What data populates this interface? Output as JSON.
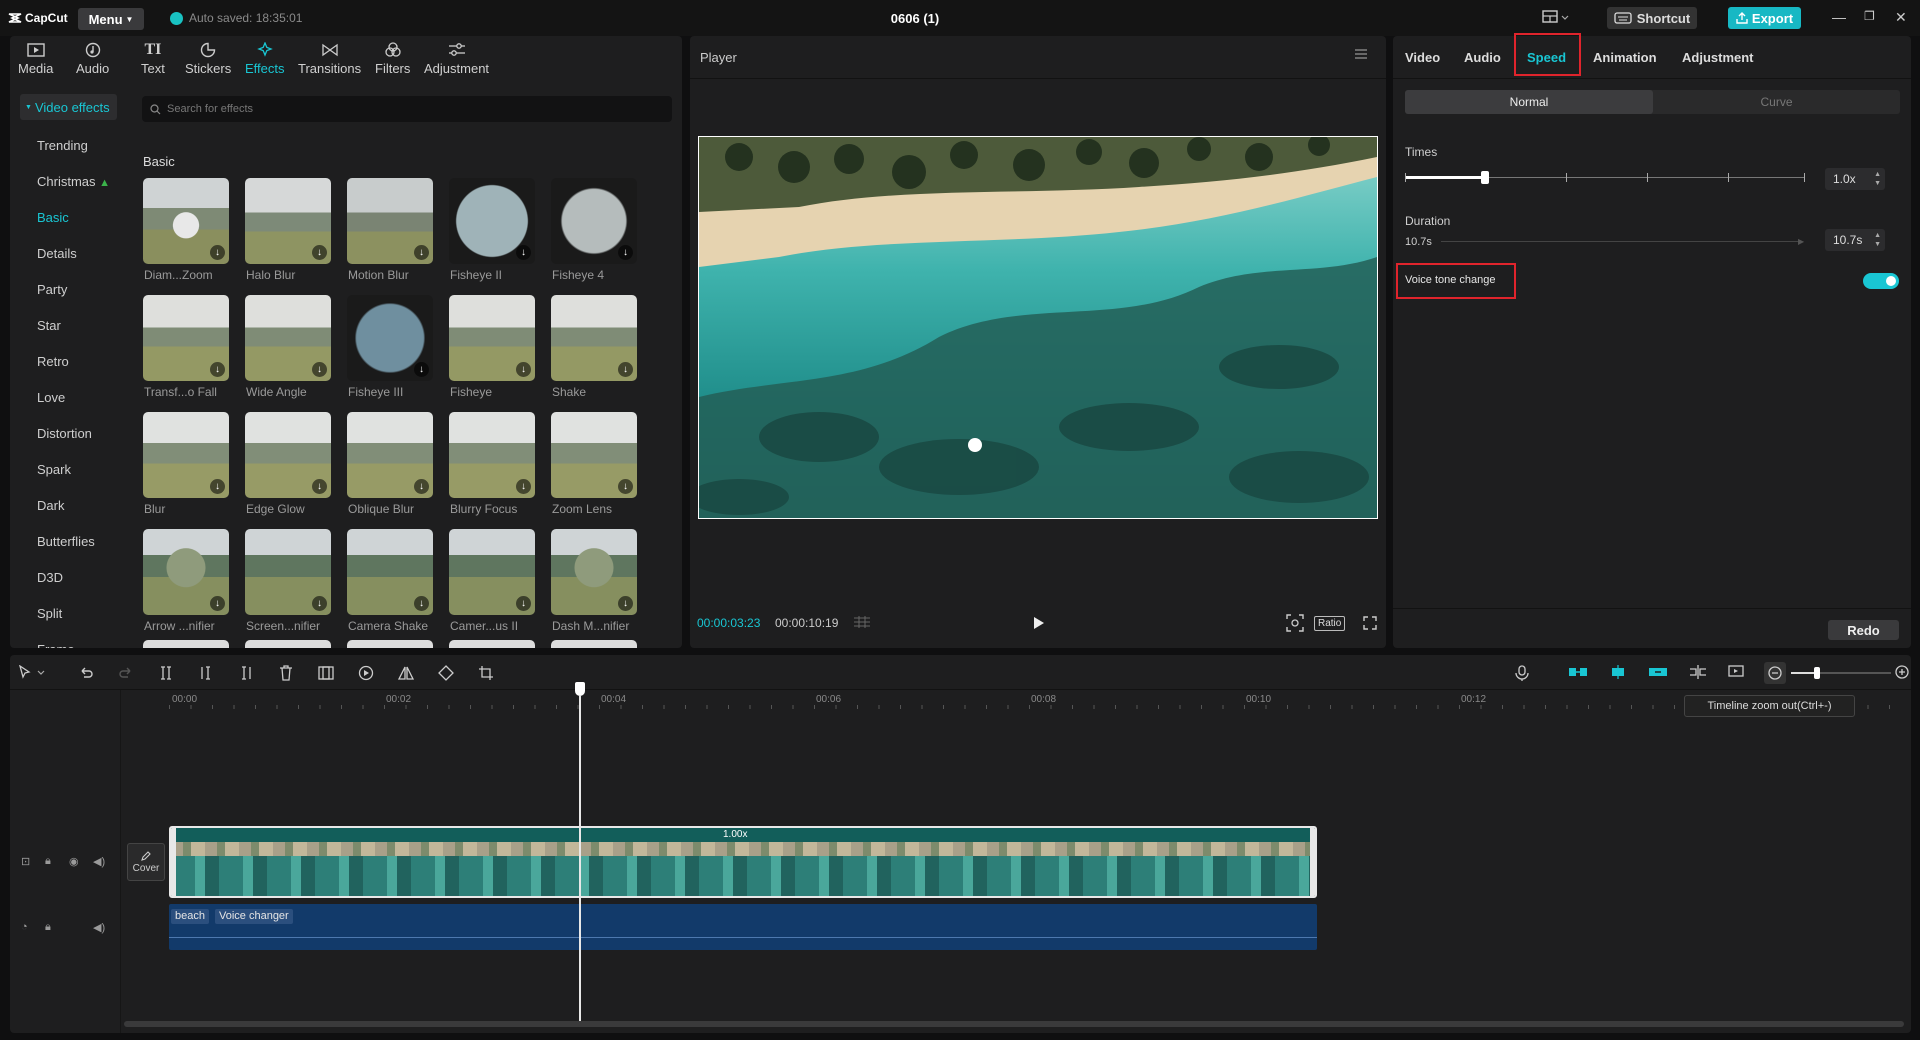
{
  "titlebar": {
    "logo": "CapCut",
    "menu": "Menu",
    "auto_saved": "Auto saved: 18:35:01",
    "project": "0606 (1)",
    "shortcut": "Shortcut",
    "export": "Export"
  },
  "toolbar": {
    "tabs": [
      "Media",
      "Audio",
      "Text",
      "Stickers",
      "Effects",
      "Transitions",
      "Filters",
      "Adjustment"
    ],
    "active": "Effects"
  },
  "effects": {
    "category": "Video effects",
    "nav": [
      "Trending",
      "Christmas",
      "Basic",
      "Details",
      "Party",
      "Star",
      "Retro",
      "Love",
      "Distortion",
      "Spark",
      "Dark",
      "Butterflies",
      "D3D",
      "Split",
      "Frame"
    ],
    "active_nav": "Basic",
    "search_placeholder": "Search for effects",
    "section": "Basic",
    "items": [
      "Diam...Zoom",
      "Halo Blur",
      "Motion Blur",
      "Fisheye II",
      "Fisheye 4",
      "Transf...o Fall",
      "Wide Angle",
      "Fisheye III",
      "Fisheye",
      "Shake",
      "Blur",
      "Edge Glow",
      "Oblique Blur",
      "Blurry Focus",
      "Zoom Lens",
      "Arrow ...nifier",
      "Screen...nifier",
      "Camera Shake",
      "Camer...us II",
      "Dash M...nifier"
    ]
  },
  "player": {
    "title": "Player",
    "current_time": "00:00:03:23",
    "total_time": "00:00:10:19",
    "ratio": "Ratio"
  },
  "inspector": {
    "tabs": [
      "Video",
      "Audio",
      "Speed",
      "Animation",
      "Adjustment"
    ],
    "active_tab": "Speed",
    "mode_normal": "Normal",
    "mode_curve": "Curve",
    "times_label": "Times",
    "times_value": "1.0x",
    "times_level": 0.2,
    "duration_label": "Duration",
    "duration_left": "10.7s",
    "duration_value": "10.7s",
    "voice_tone_label": "Voice tone change",
    "voice_tone_on": true,
    "redo": "Redo"
  },
  "timeline": {
    "ruler": [
      "00:00",
      "00:02",
      "00:04",
      "00:06",
      "00:08",
      "00:10",
      "00:12"
    ],
    "tooltip": "Timeline zoom out(Ctrl+-)",
    "cover": "Cover",
    "clip_speed": "1.00x",
    "audio_tags": [
      "beach",
      "Voice changer"
    ]
  },
  "colors": {
    "accent": "#19c6d3",
    "highlight_box": "#e0242c",
    "audio_track": "#123a6a"
  }
}
